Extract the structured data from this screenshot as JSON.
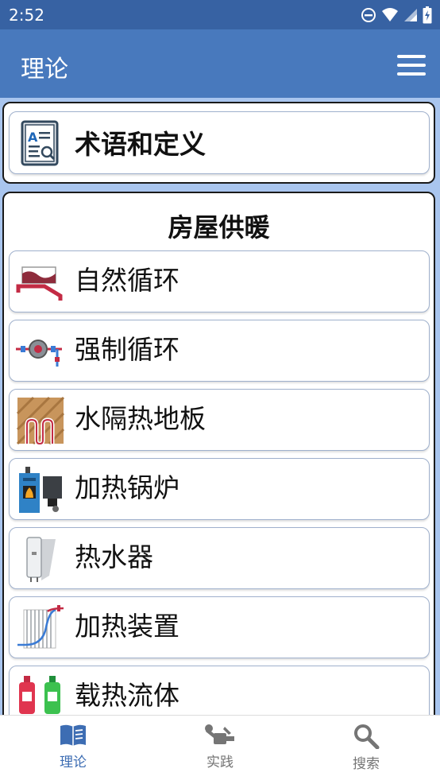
{
  "status_bar": {
    "time": "2:52"
  },
  "app_bar": {
    "title": "理论"
  },
  "top_card": {
    "item_label": "术语和定义"
  },
  "section": {
    "title": "房屋供暖",
    "items": [
      {
        "label": "自然循环",
        "icon": "natural-circulation-icon"
      },
      {
        "label": "强制循环",
        "icon": "pump-icon"
      },
      {
        "label": "水隔热地板",
        "icon": "floor-heating-icon"
      },
      {
        "label": "加热锅炉",
        "icon": "boiler-icon"
      },
      {
        "label": "热水器",
        "icon": "water-heater-icon"
      },
      {
        "label": "加热装置",
        "icon": "radiator-icon"
      },
      {
        "label": "载热流体",
        "icon": "coolant-bottles-icon"
      }
    ]
  },
  "bottom_nav": {
    "items": [
      {
        "label": "理论",
        "icon": "book-icon",
        "active": true
      },
      {
        "label": "实践",
        "icon": "tools-icon",
        "active": false
      },
      {
        "label": "搜索",
        "icon": "search-icon",
        "active": false
      }
    ]
  },
  "colors": {
    "status_bar": "#3762a3",
    "app_bar": "#4879bd",
    "background": "#a9c5ee",
    "active_nav": "#3d6db3",
    "inactive_nav": "#757575"
  }
}
